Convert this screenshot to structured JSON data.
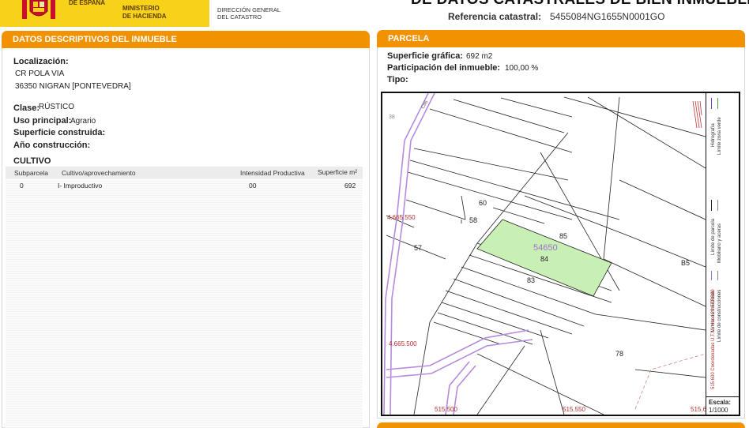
{
  "header": {
    "gov_lines": [
      "DE ESPAÑA"
    ],
    "ministry_lines": [
      "MINISTERIO",
      "DE HACIENDA"
    ],
    "directorate_lines": [
      "DIRECCIÓN GENERAL",
      "DEL CATASTRO"
    ],
    "doc_title": "DE DATOS CATASTRALES DE BIEN INMUEBLE",
    "ref_label": "Referencia catastral:",
    "ref_value": "5455084NG1655N0001GO",
    "colors": {
      "gov_yellow": "#f8d21a",
      "bar_orange": "#f39200"
    }
  },
  "left_panel": {
    "title": "DATOS DESCRIPTIVOS DEL INMUEBLE",
    "location_label": "Localización:",
    "address_line1": "CR POLA VIA",
    "address_line2": "36350 NIGRAN [PONTEVEDRA]",
    "clase_label": "Clase:",
    "clase_value": "RÚSTICO",
    "uso_label": "Uso principal:",
    "uso_value": "Agrario",
    "superficie_label": "Superficie construida:",
    "ano_label": "Año construcción:",
    "cultivo_title": "CULTIVO",
    "table": {
      "headers": [
        "Subparcela",
        "Cultivo/aprovechamiento",
        "Intensidad Productiva",
        "Superficie m²"
      ],
      "rows": [
        {
          "subparcela": "0",
          "cultivo": "I- Improductivo",
          "intensidad": "00",
          "superficie": "692"
        }
      ]
    }
  },
  "right_panel": {
    "title": "PARCELA",
    "sup_label": "Superficie gráfica:",
    "sup_value": "692 m2",
    "part_label": "Participación del inmueble:",
    "part_value": "100,00 %",
    "tipo_label": "Tipo:",
    "map": {
      "parcel_id": "54650",
      "parcel_numbers": [
        "60",
        "58",
        "57",
        "85",
        "84",
        "83",
        "B5",
        "78",
        "38"
      ],
      "road_label": "C86",
      "coords_y": [
        "4.665.550",
        "4.665.500"
      ],
      "coords_x": [
        "515.500",
        "515.550",
        "515.6"
      ],
      "legend_group1": [
        "Hidrografía",
        "Límite zona verde"
      ],
      "legend_group2": [
        "Límite de parcela",
        "Mobiliario y aceras"
      ],
      "legend_group3": [
        "Límite de manzana",
        "Límite de construcciones"
      ],
      "legend_coords": "515.600 Coordenadas U.T.M. Huso 29 ETRS89",
      "scale_label": "Escala:",
      "scale_value": "1/1000",
      "colors": {
        "highlight": "#c8f0b4",
        "road": "#b68be0",
        "coord_text": "#b03030"
      }
    }
  }
}
